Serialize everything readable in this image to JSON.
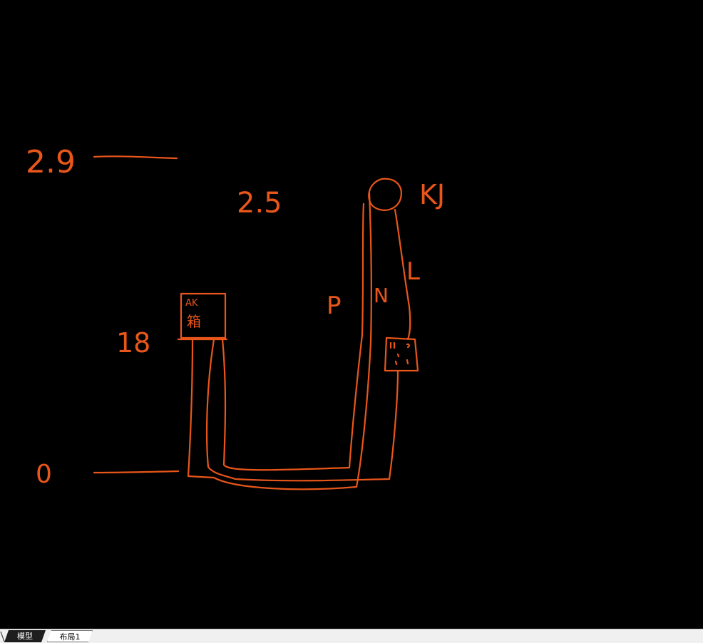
{
  "canvas": {
    "stroke_color": "#e8561a",
    "background_color": "#000000",
    "annotations": {
      "height_top": "2.9",
      "height_mid": "2.5",
      "height_low": "18",
      "height_zero": "0",
      "label_kj": "KJ",
      "label_l": "L",
      "label_n": "N",
      "label_p": "P",
      "box_line1": "AK",
      "box_line2": "箱"
    }
  },
  "tabs": {
    "model": "模型",
    "layout1": "布局1"
  }
}
